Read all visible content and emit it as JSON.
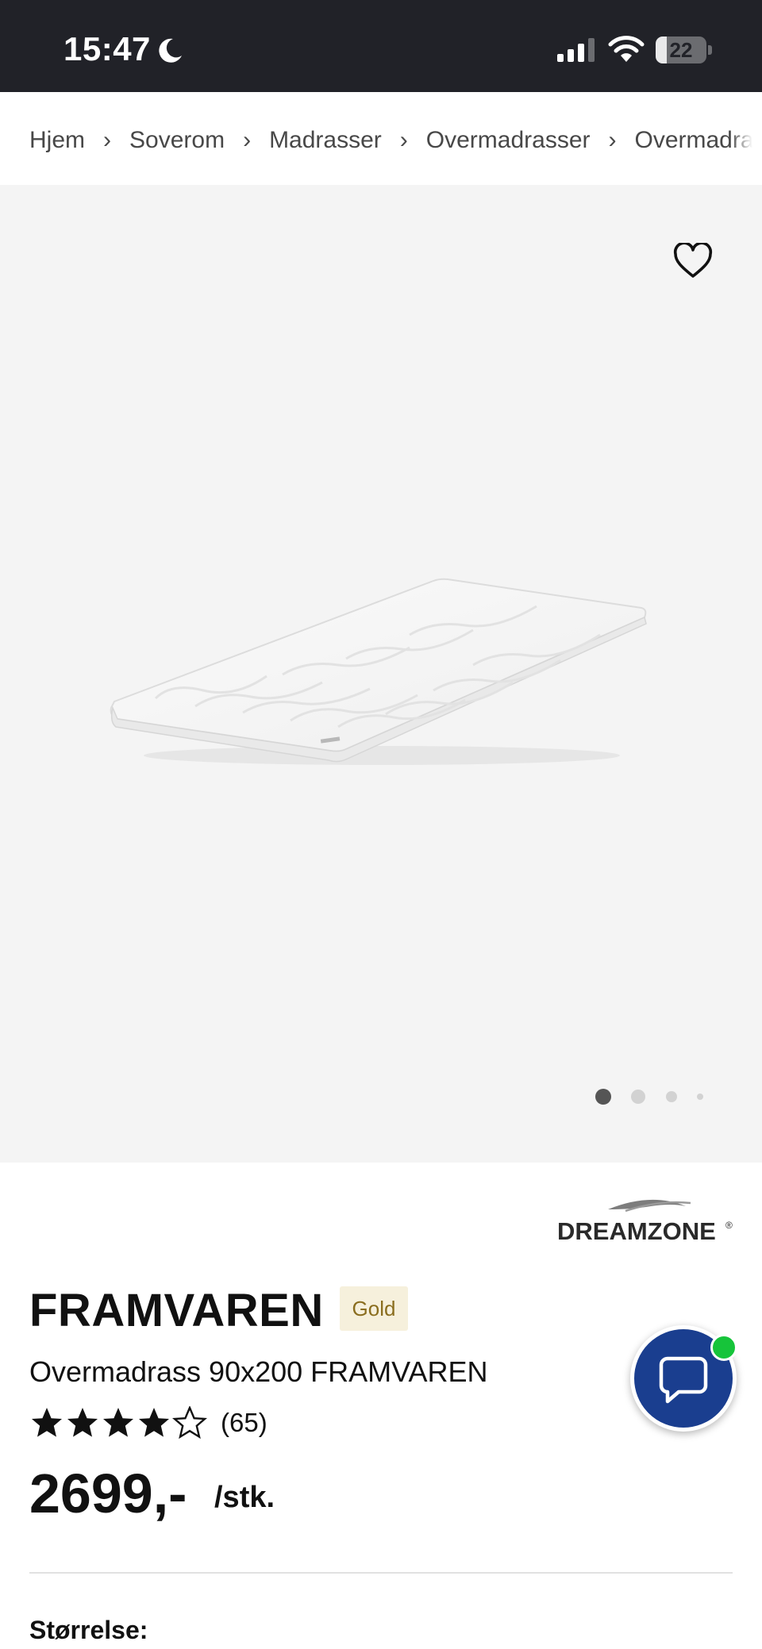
{
  "status_bar": {
    "time": "15:47",
    "battery_level": "22",
    "battery_fraction": 0.22,
    "icons": [
      "moon-icon",
      "signal-icon",
      "wifi-icon",
      "battery-icon"
    ]
  },
  "breadcrumb": {
    "items": [
      "Hjem",
      "Soverom",
      "Madrasser",
      "Overmadrasser",
      "Overmadrasser"
    ],
    "separator": "›"
  },
  "gallery": {
    "slide_count": 4,
    "active_slide": 1,
    "favorite_icon": "heart-icon"
  },
  "product": {
    "brand": "DREAMZONE",
    "brand_mark": "®",
    "name": "FRAMVAREN",
    "badge": "Gold",
    "subtitle": "Overmadrass 90x200 FRAMVAREN",
    "rating": 4,
    "rating_max": 5,
    "review_count": "(65)",
    "price": "2699,-",
    "price_unit": "/stk.",
    "size_label": "Størrelse:"
  },
  "chat": {
    "icon": "chat-bubble-icon",
    "online_color": "#16c43a",
    "button_color": "#1a3e8f"
  },
  "colors": {
    "status_bar_bg": "#212228",
    "gallery_bg": "#f4f4f4",
    "badge_bg": "#f6f0dc"
  }
}
